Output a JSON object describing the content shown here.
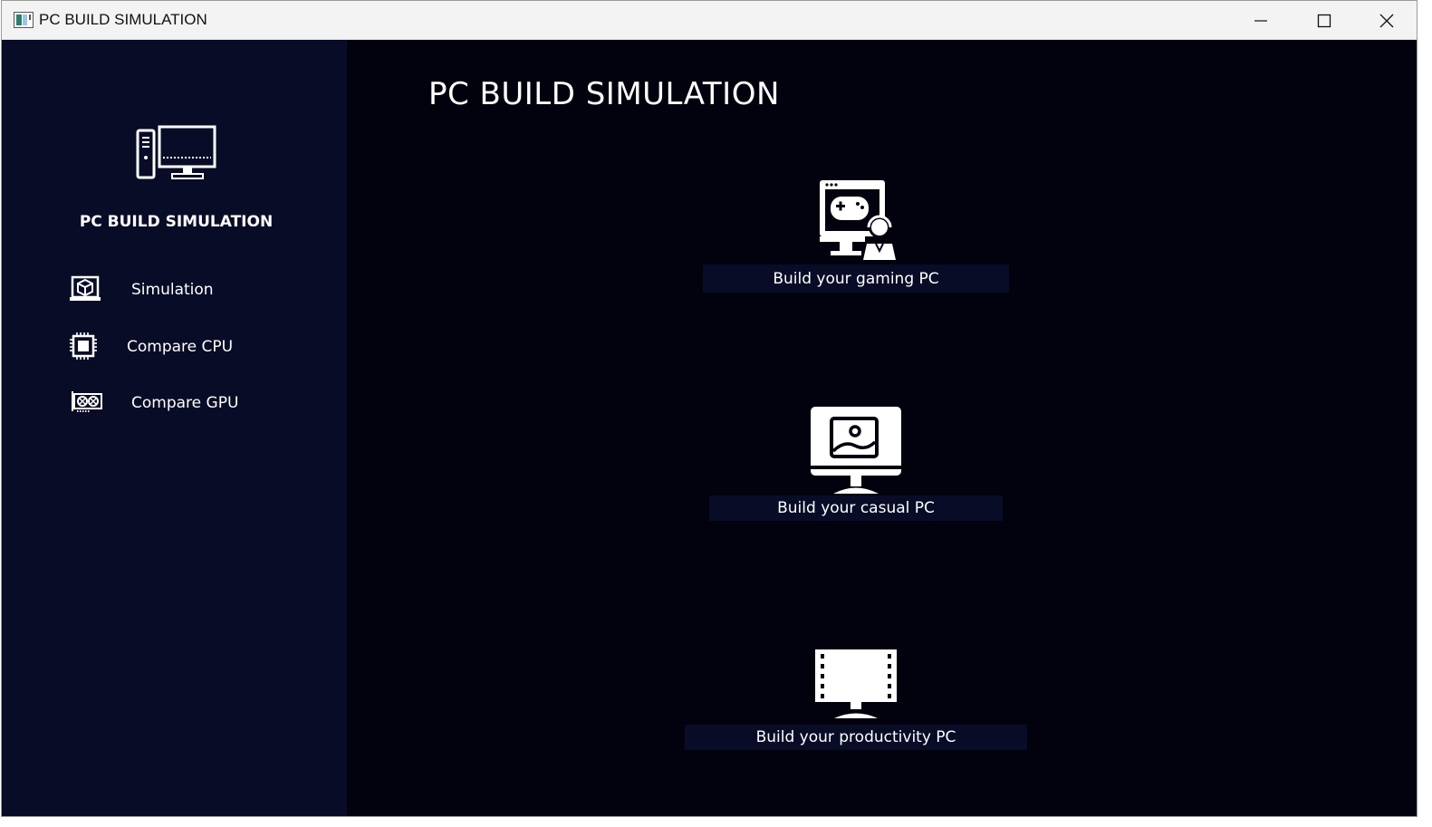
{
  "window": {
    "title": "PC BUILD SIMULATION",
    "controls": [
      "minimize",
      "maximize",
      "close"
    ]
  },
  "sidebar": {
    "logo_icon": "desktop-computer-icon",
    "title": "PC BUILD SIMULATION",
    "items": [
      {
        "label": "Simulation",
        "icon": "laptop-box-icon"
      },
      {
        "label": "Compare CPU",
        "icon": "cpu-chip-icon"
      },
      {
        "label": "Compare GPU",
        "icon": "graphics-card-icon"
      }
    ]
  },
  "main": {
    "title": "PC BUILD SIMULATION",
    "options": [
      {
        "label": "Build your gaming PC",
        "icon": "gamer-monitor-icon"
      },
      {
        "label": "Build your casual PC",
        "icon": "image-monitor-icon"
      },
      {
        "label": "Build your productivity PC",
        "icon": "film-monitor-icon"
      }
    ]
  },
  "colors": {
    "sidebar_bg": "#090c26",
    "main_bg": "#02020e",
    "button_bg": "#090c26",
    "text": "#ffffff",
    "titlebar_bg": "#f3f3f3"
  }
}
